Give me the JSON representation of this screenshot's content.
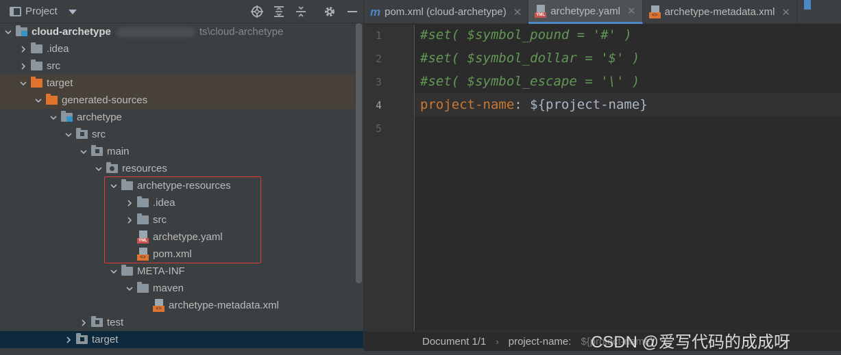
{
  "project_panel": {
    "title": "Project",
    "header_icons": [
      "locate-icon",
      "expand-all-icon",
      "collapse-all-icon",
      "gear-icon",
      "minimize-icon"
    ],
    "root_path_suffix": "ts\\cloud-archetype",
    "tree": [
      {
        "label": "cloud-archetype",
        "icon": "module-folder",
        "expanded": true
      },
      {
        "label": ".idea",
        "icon": "folder",
        "expanded": false
      },
      {
        "label": "src",
        "icon": "folder",
        "expanded": false
      },
      {
        "label": "target",
        "icon": "orange-folder",
        "expanded": true
      },
      {
        "label": "generated-sources",
        "icon": "orange-folder",
        "expanded": true
      },
      {
        "label": "archetype",
        "icon": "module-folder",
        "expanded": true
      },
      {
        "label": "src",
        "icon": "source-folder",
        "expanded": true
      },
      {
        "label": "main",
        "icon": "source-folder",
        "expanded": true
      },
      {
        "label": "resources",
        "icon": "resources-folder",
        "expanded": true
      },
      {
        "label": "archetype-resources",
        "icon": "folder",
        "expanded": true
      },
      {
        "label": ".idea",
        "icon": "folder",
        "expanded": false
      },
      {
        "label": "src",
        "icon": "folder",
        "expanded": false
      },
      {
        "label": "archetype.yaml",
        "icon": "yaml-file"
      },
      {
        "label": "pom.xml",
        "icon": "xml-file"
      },
      {
        "label": "META-INF",
        "icon": "folder",
        "expanded": true
      },
      {
        "label": "maven",
        "icon": "folder",
        "expanded": true
      },
      {
        "label": "archetype-metadata.xml",
        "icon": "xml-file"
      },
      {
        "label": "test",
        "icon": "source-folder",
        "expanded": false
      },
      {
        "label": "target",
        "icon": "blue-folder",
        "expanded": false
      }
    ]
  },
  "tabs": [
    {
      "label": "pom.xml (cloud-archetype)",
      "icon": "maven-icon",
      "active": false
    },
    {
      "label": "archetype.yaml",
      "icon": "yaml-file-icon",
      "active": true
    },
    {
      "label": "archetype-metadata.xml",
      "icon": "xml-file-icon",
      "active": false
    }
  ],
  "editor": {
    "line_numbers": [
      "1",
      "2",
      "3",
      "4",
      "5"
    ],
    "current_line": 4,
    "lines": [
      {
        "segments": [
          {
            "type": "comment",
            "text": "#set( $symbol_pound = '#' )"
          }
        ]
      },
      {
        "segments": [
          {
            "type": "comment",
            "text": "#set( $symbol_dollar = '$' )"
          }
        ]
      },
      {
        "segments": [
          {
            "type": "comment",
            "text": "#set( $symbol_escape = '\\' )"
          }
        ]
      },
      {
        "segments": [
          {
            "type": "key",
            "text": "project-name"
          },
          {
            "type": "plain",
            "text": ": ${project-name}"
          }
        ]
      },
      {
        "segments": []
      }
    ]
  },
  "breadcrumb": {
    "items": [
      "Document 1/1",
      "project-name:"
    ],
    "ghost": "${project-name}"
  },
  "watermark": "CSDN @爱写代码的成成呀",
  "colors": {
    "panel_bg": "#3c3f41",
    "editor_bg": "#2b2b2b",
    "comment": "#629755",
    "yaml_key": "#cc7832",
    "highlight_box": "#e03b3b",
    "selection": "#0d293e"
  }
}
